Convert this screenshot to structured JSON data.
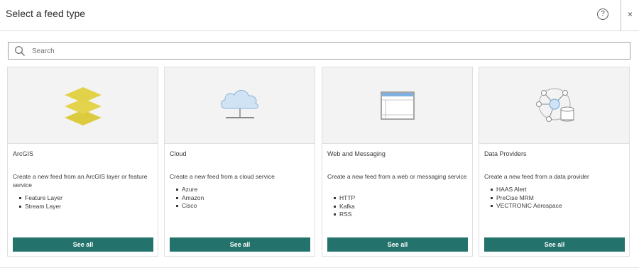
{
  "header": {
    "title": "Select a feed type",
    "help_label": "?",
    "close_label": "×"
  },
  "search": {
    "placeholder": "Search",
    "value": ""
  },
  "cards": [
    {
      "title": "ArcGIS",
      "description": "Create a new feed from an ArcGIS layer or feature service",
      "items": [
        "Feature Layer",
        "Stream Layer"
      ],
      "button_label": "See all",
      "icon": "layers-icon"
    },
    {
      "title": "Cloud",
      "description": "Create a new feed from a cloud service",
      "items": [
        "Azure",
        "Amazon",
        "Cisco"
      ],
      "button_label": "See all",
      "icon": "cloud-icon"
    },
    {
      "title": "Web and Messaging",
      "description": "Create a new feed from a web or messaging service",
      "items": [
        "HTTP",
        "Kafka",
        "RSS"
      ],
      "button_label": "See all",
      "icon": "browser-window-icon"
    },
    {
      "title": "Data Providers",
      "description": "Create a new feed from a data provider",
      "items": [
        "HAAS Alert",
        "PreCise MRM",
        "VECTRONIC Aerospace"
      ],
      "button_label": "See all",
      "icon": "data-network-icon"
    }
  ],
  "colors": {
    "accent": "#23726b",
    "layers_fill": "#e1d24a",
    "cloud_fill": "#cfe3f5",
    "cloud_stroke": "#8fb3d6"
  }
}
